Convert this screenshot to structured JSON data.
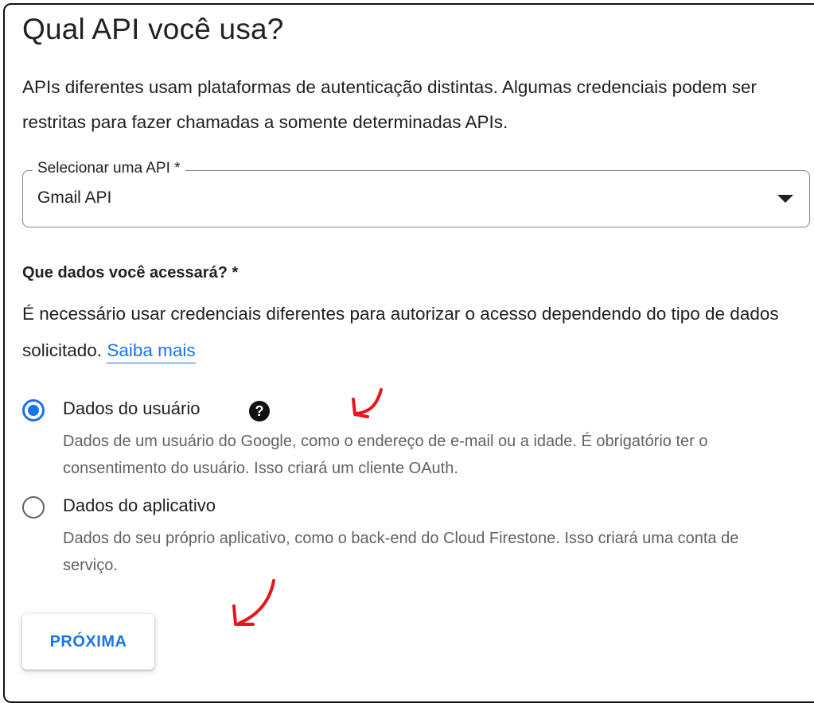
{
  "header": {
    "title": "Qual API você usa?",
    "description": "APIs diferentes usam plataformas de autenticação distintas. Algumas credenciais podem ser restritas para fazer chamadas a somente determinadas APIs."
  },
  "api_select": {
    "label": "Selecionar uma API *",
    "value": "Gmail API"
  },
  "data_section": {
    "title": "Que dados você acessará? *",
    "description": "É necessário usar credenciais diferentes para autorizar o acesso dependendo do tipo de dados solicitado.",
    "link_text": "Saiba mais"
  },
  "options": [
    {
      "label": "Dados do usuário",
      "description": "Dados de um usuário do Google, como o endereço de e-mail ou a idade. É obrigatório ter o consentimento do usuário. Isso criará um cliente OAuth.",
      "selected": true,
      "help_icon": "question-mark-circle-icon"
    },
    {
      "label": "Dados do aplicativo",
      "description": "Dados do seu próprio aplicativo, como o back-end do Cloud Firestone. Isso criará uma conta de serviço.",
      "selected": false
    }
  ],
  "next_button": {
    "label": "PRÓXIMA"
  },
  "colors": {
    "accent": "#1a73e8",
    "text_primary": "#202124",
    "text_secondary": "#5f6368",
    "annotation": "#e8141a"
  }
}
